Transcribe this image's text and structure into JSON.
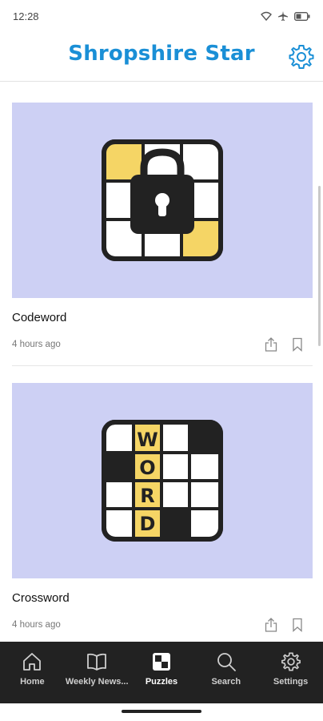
{
  "status": {
    "time": "12:28"
  },
  "header": {
    "title": "Shropshire Star"
  },
  "colors": {
    "brand": "#1a8fd6",
    "card_bg": "#cdd0f4",
    "accent_yellow": "#f5d565",
    "nav_bg": "#222222"
  },
  "cards": [
    {
      "title": "Codeword",
      "time": "4 hours ago"
    },
    {
      "title": "Crossword",
      "time": "4 hours ago",
      "word_letters": [
        "W",
        "O",
        "R",
        "D"
      ]
    }
  ],
  "nav": {
    "items": [
      {
        "label": "Home",
        "icon": "home-icon"
      },
      {
        "label": "Weekly News...",
        "icon": "book-icon"
      },
      {
        "label": "Puzzles",
        "icon": "puzzle-icon",
        "active": true
      },
      {
        "label": "Search",
        "icon": "search-icon"
      },
      {
        "label": "Settings",
        "icon": "gear-icon"
      }
    ]
  }
}
